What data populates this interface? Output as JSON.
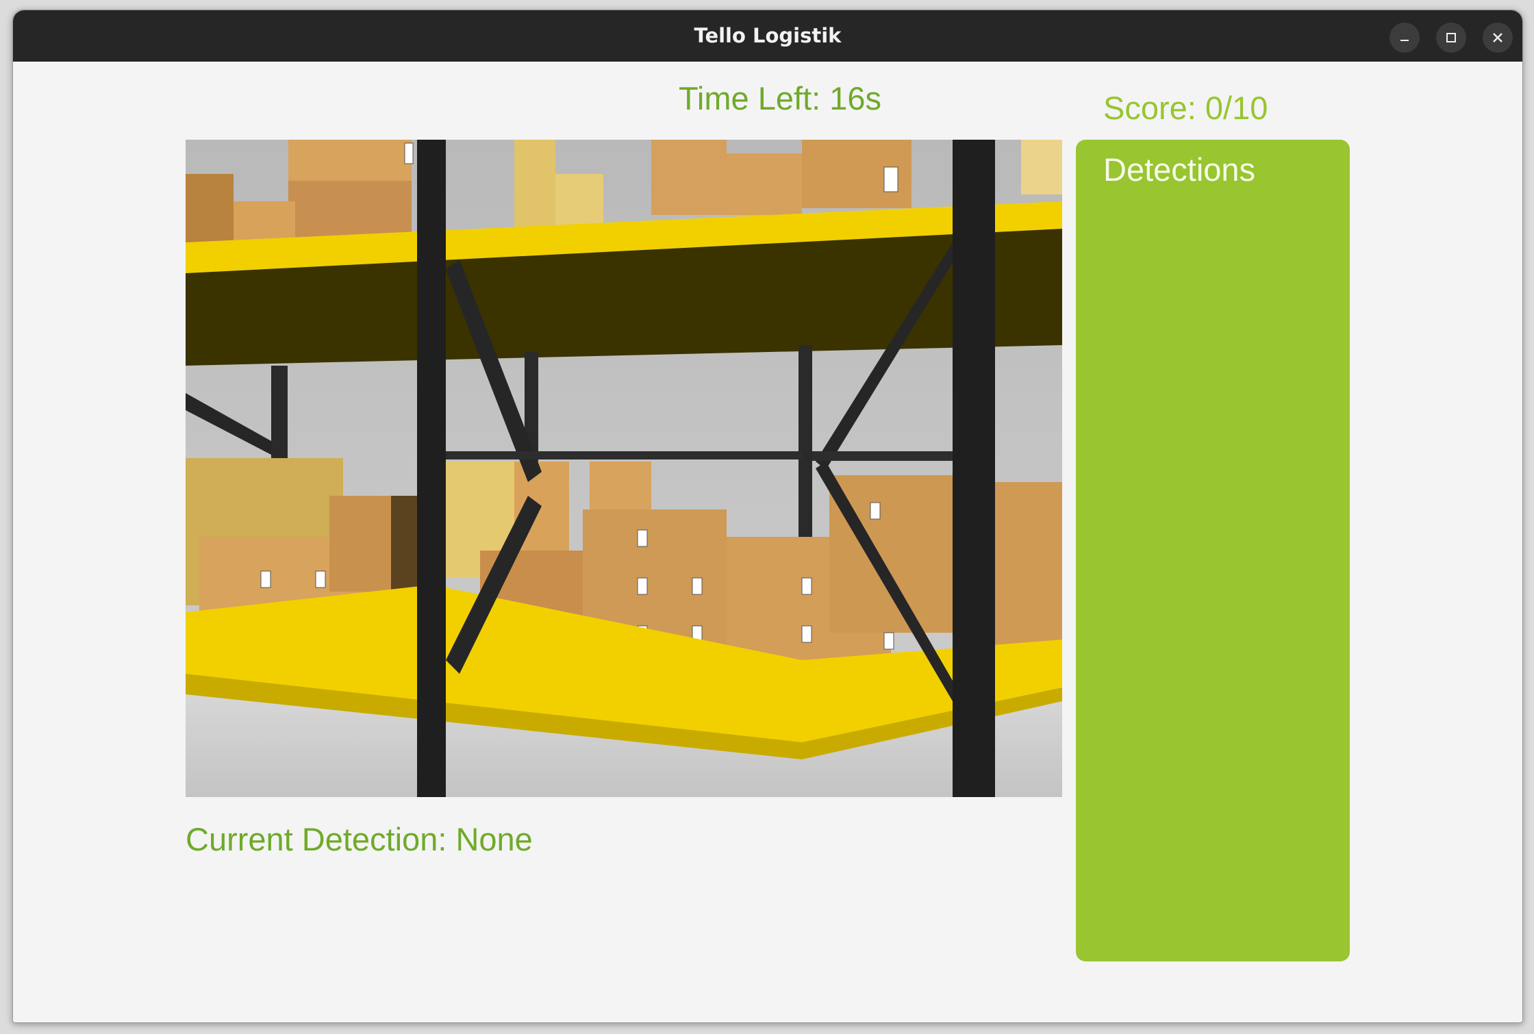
{
  "window": {
    "title": "Tello Logistik"
  },
  "hud": {
    "time_left": "Time Left: 16s",
    "score": "Score: 0/10",
    "current_detection": "Current Detection: None"
  },
  "detections_panel": {
    "title": "Detections",
    "items": []
  },
  "camera_feed": {
    "scene": "warehouse-shelves-with-boxes"
  },
  "colors": {
    "accent_green": "#98c530",
    "text_green": "#6faa2a",
    "titlebar": "#262626",
    "shelf_yellow": "#f2d000",
    "rack_black": "#222222"
  }
}
